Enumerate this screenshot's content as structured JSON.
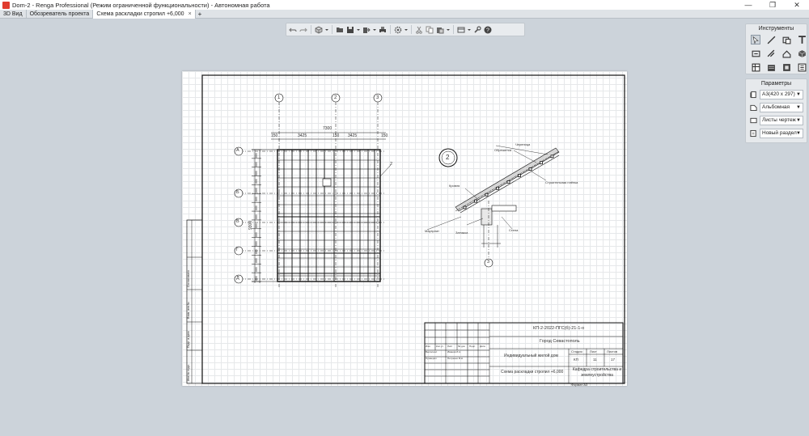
{
  "app": {
    "title": "Dom-2 - Renga Professional (Режим ограниченной функциональности) - Автономная работа",
    "minimize": "—",
    "maximize": "❐",
    "close": "✕"
  },
  "tabs": [
    {
      "label": "3D Вид",
      "active": false
    },
    {
      "label": "Обозреватель проекта",
      "active": false
    },
    {
      "label": "Схема раскладки стропил +6,000",
      "active": true
    }
  ],
  "tab_close": "×",
  "tab_add": "+",
  "toolbar": {
    "icons": [
      "undo-icon",
      "redo-icon",
      "cube-view-icon",
      "open-folder-icon",
      "save-icon",
      "export-icon",
      "print-icon",
      "settings-gear-icon",
      "cut-icon",
      "copy-icon",
      "paste-icon",
      "sheet-view-icon",
      "wrench-icon",
      "help-icon"
    ]
  },
  "tools_panel": {
    "title": "Инструменты",
    "icons": [
      "select-icon",
      "line-icon",
      "rectangle-icon",
      "text-icon",
      "dimension-icon",
      "rebar-icon",
      "section-icon",
      "3d-box-icon",
      "table-icon",
      "layout-icon",
      "stamp-icon",
      "list-icon"
    ]
  },
  "params_panel": {
    "title": "Параметры",
    "rows": [
      {
        "icon": "page-format-icon",
        "value": "А3(420 x 297)"
      },
      {
        "icon": "orientation-icon",
        "value": "Альбомная"
      },
      {
        "icon": "sheets-icon",
        "value": "Листы чертеж"
      },
      {
        "icon": "section-new-icon",
        "value": "Новый раздел"
      }
    ]
  },
  "drawing": {
    "axes_top": [
      "1",
      "2",
      "3"
    ],
    "axes_left": [
      "А",
      "Б",
      "В",
      "Г",
      "Д"
    ],
    "dim_total": "7300",
    "dim_segments": [
      "150",
      "3425",
      "150",
      "3425",
      "150"
    ],
    "dim_left_total": "9300",
    "dim_left_pitch": [
      "880",
      "880",
      "880",
      "880",
      "880",
      "880",
      "880",
      "880",
      "880",
      "880",
      "880",
      "880",
      "880",
      "880",
      "880"
    ],
    "leader": "2",
    "detail_mark": "2",
    "detail_axis": "3",
    "detail_labels": {
      "tile": "Черепица",
      "lathing": "Обрешетка",
      "membrane": "Строительная плёнка",
      "roof": "Кровля",
      "mauerlat": "Мауэрлат",
      "wall": "Стена",
      "support": "Затяжка"
    }
  },
  "stamp": {
    "code": "КП-2-2022-ПГС(б)-21-1-о",
    "city": "Город Севастополь",
    "object": "Индивидуальный жилой дом",
    "sheet_title": "Схема раскладки стропил +6,000",
    "org": "Кафедра строительства и землеустройства",
    "col_stage": "Стадия",
    "col_sheet": "Лист",
    "col_sheets": "Листов",
    "stage": "КП",
    "sheet": "11",
    "sheets": "17",
    "format": "Формат А3",
    "hdr": [
      "Изм.",
      "Кол.уч",
      "Лист",
      "№ док",
      "Подп.",
      "Дата"
    ],
    "roles": [
      [
        "Выполнил",
        "Иванов И.А."
      ],
      [
        "Проверил",
        "Петренко В.Н."
      ]
    ],
    "side": [
      "Инв.№ подл.",
      "Подп. и дата",
      "Взам. инв.№",
      "Согласовано"
    ]
  }
}
